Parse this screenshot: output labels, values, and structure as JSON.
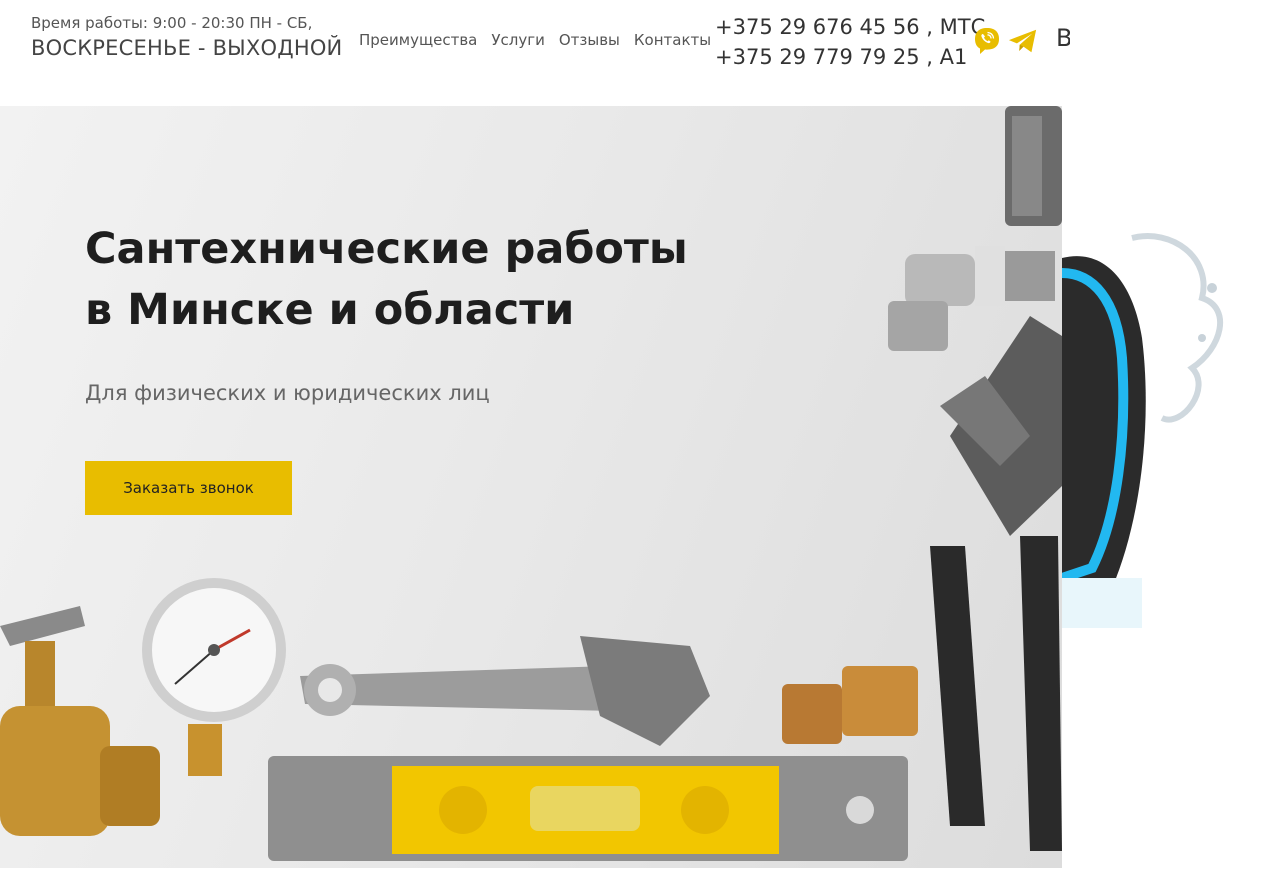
{
  "header": {
    "hours_line1": "Время работы: 9:00 - 20:30 ПН - СБ,",
    "hours_line2": "ВОСКРЕСЕНЬЕ - ВЫХОДНОЙ",
    "nav": [
      "Преимущества",
      "Услуги",
      "Отзывы",
      "Контакты"
    ],
    "phones": [
      "+375 29 676 45 56 , МТС",
      "+375 29 779 79 25 , А1"
    ],
    "cut_glyph": "В",
    "icons": [
      "viber-icon",
      "telegram-icon"
    ]
  },
  "hero": {
    "title_line1": "Сантехнические работы",
    "title_line2": "в Минске и области",
    "subtitle": "Для физических и юридических лиц",
    "cta": "Заказать звонок"
  },
  "colors": {
    "accent": "#e8bd00",
    "messenger_icons": "#e8bd00",
    "title": "#1e1e1e"
  }
}
